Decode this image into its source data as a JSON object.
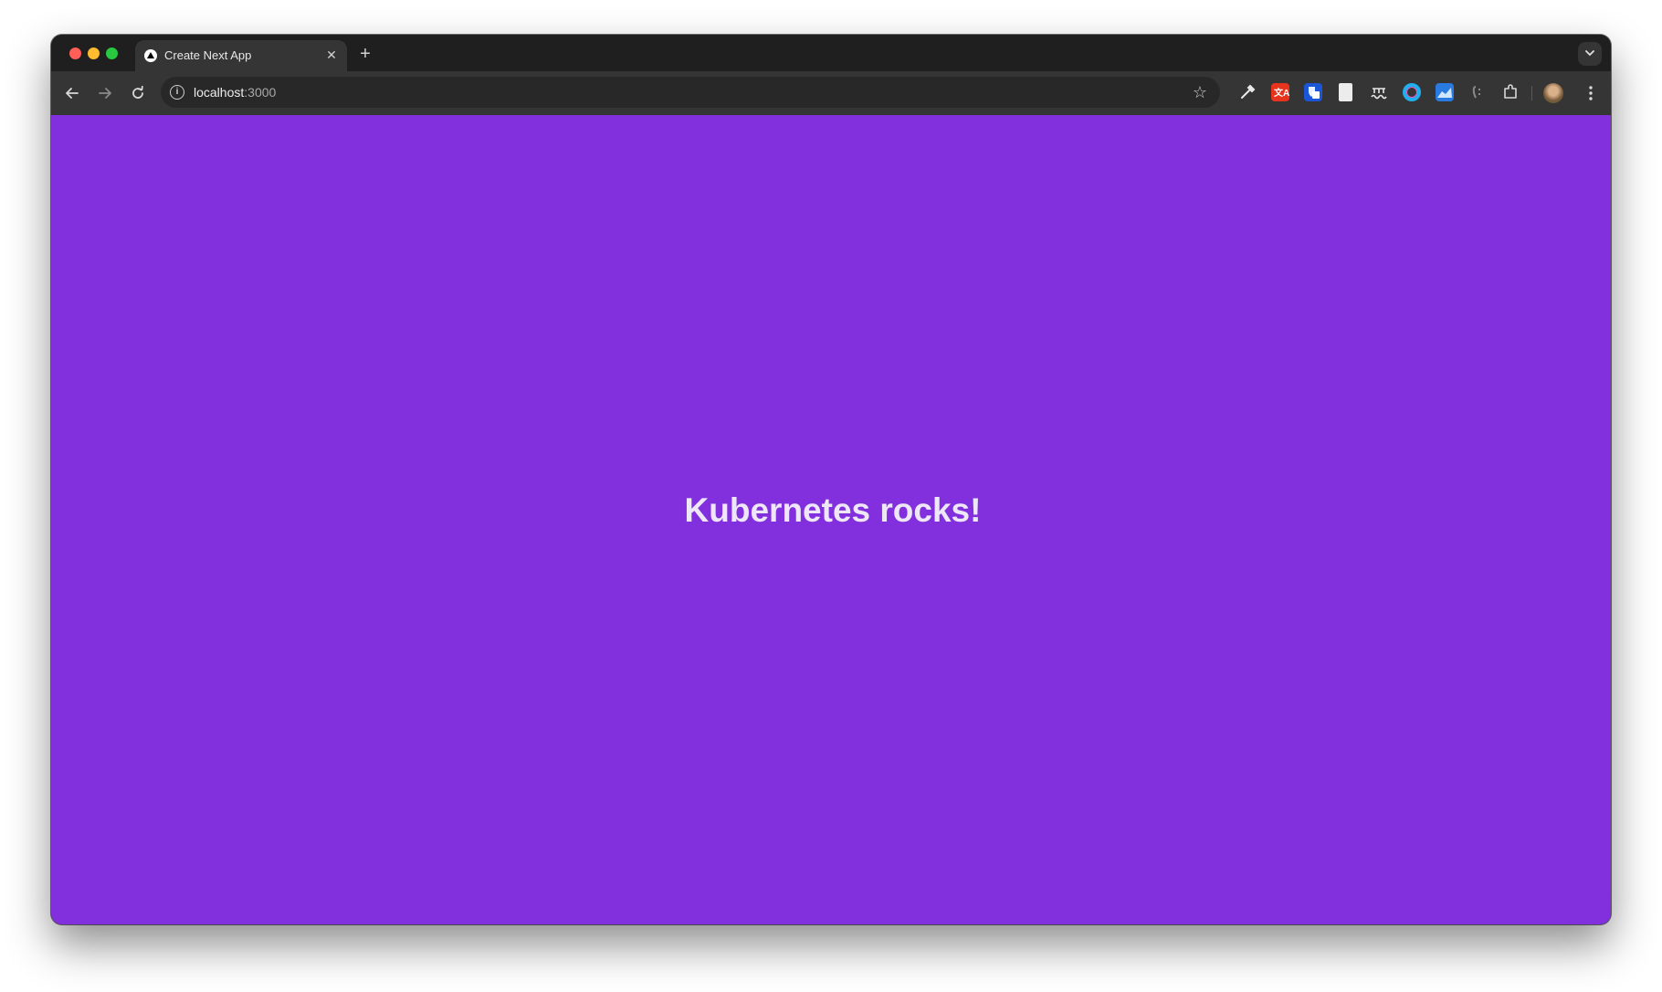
{
  "browser": {
    "tab": {
      "title": "Create Next App",
      "close_glyph": "✕",
      "favicon": "nextjs-triangle-icon"
    },
    "new_tab_glyph": "+",
    "toolbar": {
      "url_host": "localhost",
      "url_port": ":3000",
      "bookmark_glyph": "☆",
      "info_glyph": "i",
      "extensions": [
        "eyedropper-icon",
        "translate-icon",
        "shield-icon",
        "document-icon",
        "waves-icon",
        "color-ring-icon",
        "chart-icon",
        "code-icon",
        "puzzle-icon"
      ]
    }
  },
  "page": {
    "headline": "Kubernetes rocks!",
    "background_color": "#8230de",
    "text_color": "#eee7f8"
  }
}
